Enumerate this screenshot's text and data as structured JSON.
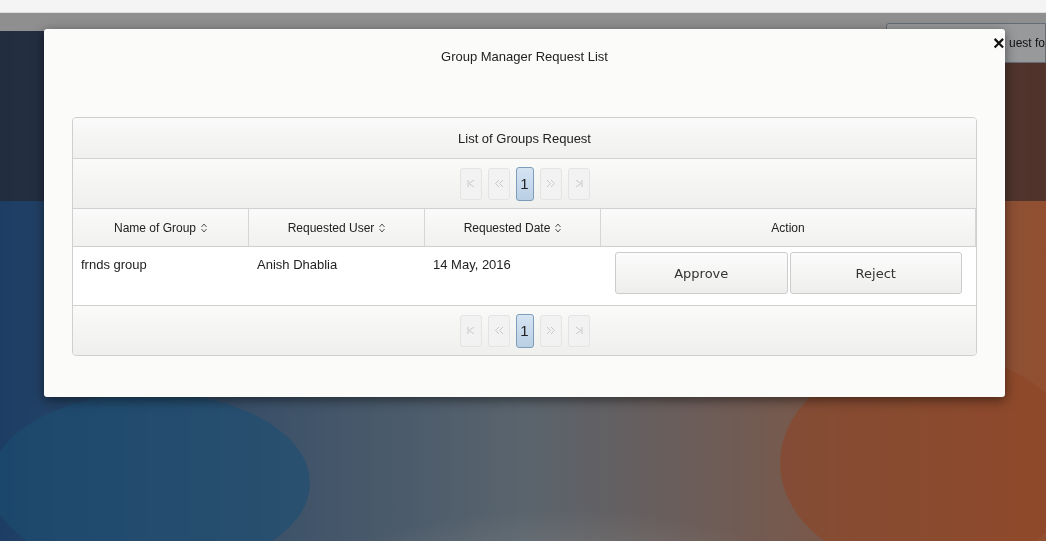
{
  "background_page": {
    "partial_text": "uest fo"
  },
  "dialog": {
    "title": "Group Manager Request List",
    "close": "×"
  },
  "panel": {
    "title": "List of Groups Request",
    "paginators": [
      {
        "pages": [
          {
            "label": "1",
            "selected": true
          }
        ]
      },
      {
        "pages": [
          {
            "label": "1",
            "selected": true
          }
        ]
      }
    ],
    "columns": [
      {
        "label": "Name of Group",
        "sortable": true
      },
      {
        "label": "Requested User",
        "sortable": true
      },
      {
        "label": "Requested Date",
        "sortable": true
      },
      {
        "label": "Action",
        "sortable": false
      }
    ],
    "rows": [
      {
        "cells": [
          "frnds group",
          "Anish Dhablia",
          "14 May, 2016"
        ],
        "actions": [
          "Approve",
          "Reject"
        ]
      }
    ]
  }
}
